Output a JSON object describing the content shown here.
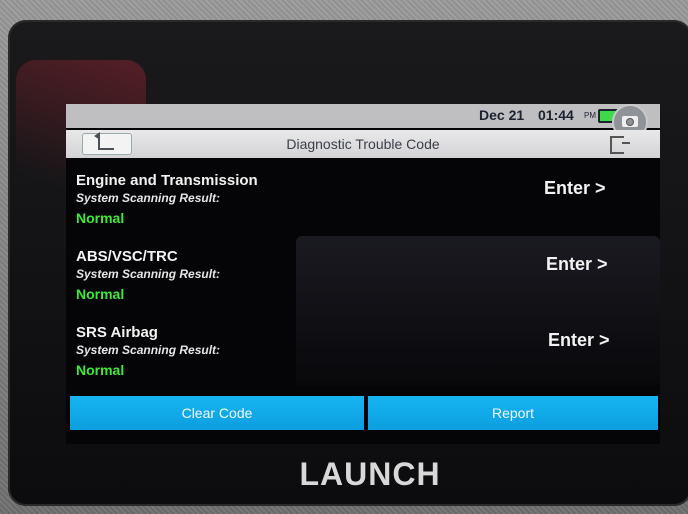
{
  "statusbar": {
    "date": "Dec 21",
    "time": "01:44",
    "ampm": "PM"
  },
  "header": {
    "title": "Diagnostic Trouble Code"
  },
  "systems": [
    {
      "name": "Engine and Transmission",
      "scan_label": "System Scanning Result:",
      "result": "Normal",
      "enter_label": "Enter >"
    },
    {
      "name": "ABS/VSC/TRC",
      "scan_label": "System Scanning Result:",
      "result": "Normal",
      "enter_label": "Enter >"
    },
    {
      "name": "SRS Airbag",
      "scan_label": "System Scanning Result:",
      "result": "Normal",
      "enter_label": "Enter >"
    }
  ],
  "footer": {
    "clear_label": "Clear Code",
    "report_label": "Report"
  },
  "device": {
    "brand": "LAUNCH"
  },
  "colors": {
    "accent": "#16b5f2",
    "normal": "#3fe83a",
    "battery": "#3fd84b"
  },
  "icons": [
    "back-arrow-icon",
    "exit-icon",
    "battery-icon",
    "camera-icon"
  ]
}
